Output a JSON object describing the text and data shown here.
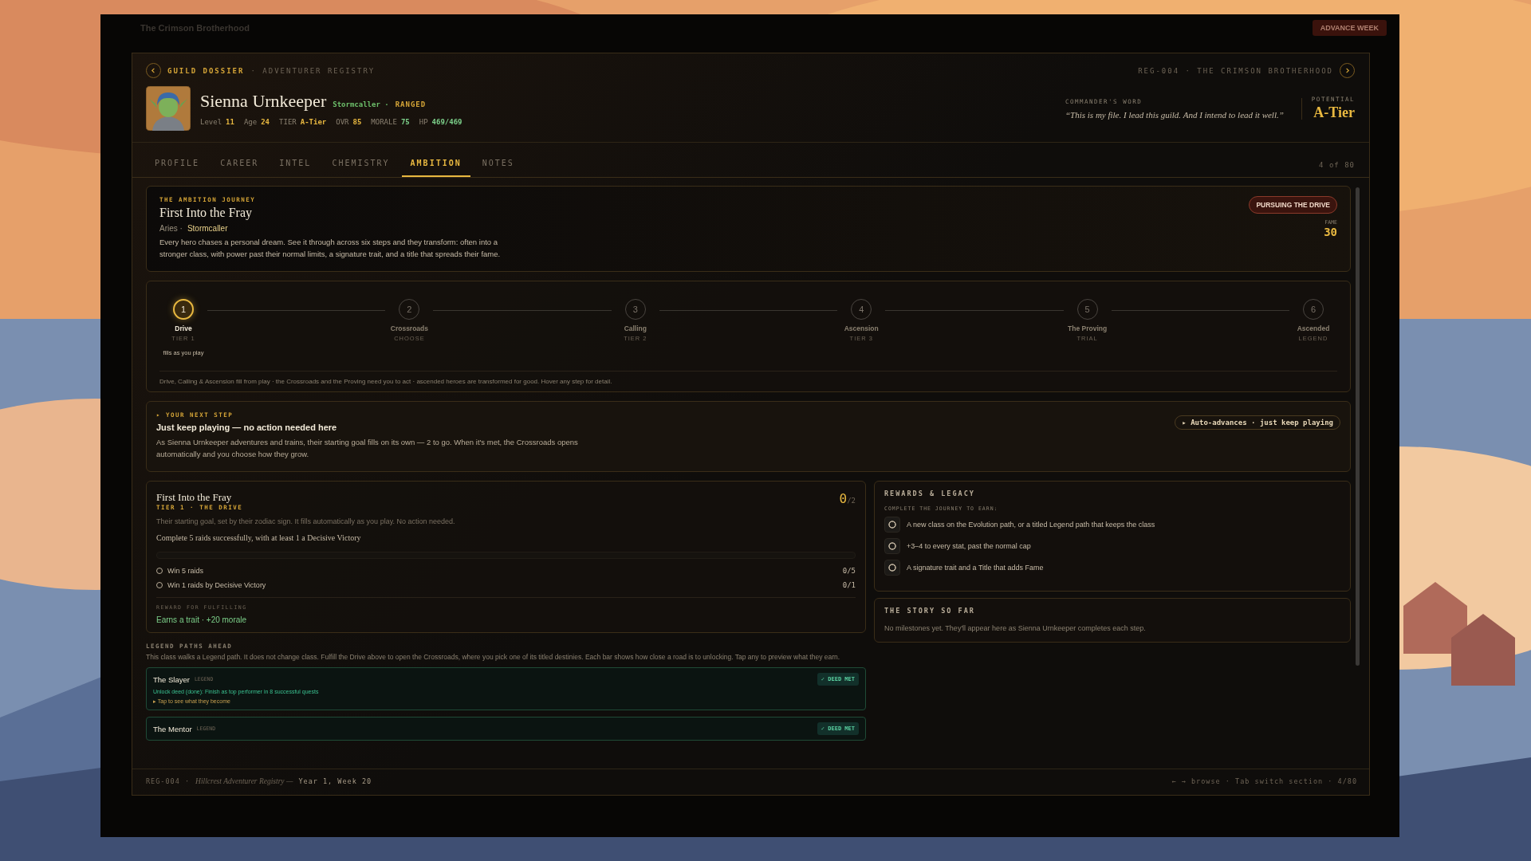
{
  "app": {
    "title": "The Crimson Brotherhood",
    "action": "ADVANCE WEEK"
  },
  "dossier": {
    "crumb": "GUILD DOSSIER",
    "crumb_sub": "· ADVENTURER REGISTRY",
    "registry": "REG-004 · THE CRIMSON BROTHERHOOD"
  },
  "hero": {
    "name": "Sienna Urnkeeper",
    "class": "Stormcaller ·",
    "role": "RANGED",
    "stats": [
      {
        "label": "Level",
        "value": "11",
        "color": "#e8b840"
      },
      {
        "label": "Age",
        "value": "24",
        "color": "#e8b840"
      },
      {
        "label": "TIER",
        "value": "A-Tier",
        "color": "#e8b840"
      },
      {
        "label": "OVR",
        "value": "85",
        "color": "#e8b840"
      },
      {
        "label": "MORALE",
        "value": "75",
        "color": "#7cd08a"
      },
      {
        "label": "HP",
        "value": "469/469",
        "color": "#7cd08a"
      }
    ],
    "quote_label": "COMMANDER'S WORD",
    "quote": "“This is my file. I lead this guild. And I intend to lead it well.”",
    "potential_label": "POTENTIAL",
    "potential": "A-Tier"
  },
  "tabs": [
    {
      "label": "PROFILE",
      "selected": false
    },
    {
      "label": "CAREER",
      "selected": false
    },
    {
      "label": "INTEL",
      "selected": false
    },
    {
      "label": "CHEMISTRY",
      "selected": false
    },
    {
      "label": "AMBITION",
      "selected": true
    },
    {
      "label": "NOTES",
      "selected": false
    }
  ],
  "position": "4 of 80",
  "journey": {
    "eyebrow": "THE AMBITION JOURNEY",
    "title": "First Into the Fray",
    "sign": "Aries ·",
    "class": "Stormcaller",
    "text": "Every hero chases a personal dream. See it through across six steps and they transform: often into a stronger class, with power past their normal limits, a signature trait, and a title that spreads their fame.",
    "status": "PURSUING THE DRIVE",
    "fame_label": "FAME",
    "fame": "30"
  },
  "steps": [
    {
      "number": "1",
      "name": "Drive",
      "sub": "TIER 1",
      "note": "fills as you play",
      "selected": true
    },
    {
      "number": "2",
      "name": "Crossroads",
      "sub": "CHOOSE",
      "selected": false
    },
    {
      "number": "3",
      "name": "Calling",
      "sub": "TIER 2",
      "selected": false
    },
    {
      "number": "4",
      "name": "Ascension",
      "sub": "TIER 3",
      "selected": false
    },
    {
      "number": "5",
      "name": "The Proving",
      "sub": "TRIAL",
      "selected": false
    },
    {
      "number": "6",
      "name": "Ascended",
      "sub": "LEGEND",
      "selected": false
    }
  ],
  "steps_note": "Drive, Calling & Ascension fill from play · the Crossroads and the Proving need you to act · ascended heroes are transformed for good. Hover any step for detail.",
  "next_step": {
    "eyebrow": "▸ YOUR NEXT STEP",
    "title": "Just keep playing — no action needed here",
    "text": "As Sienna Urnkeeper adventures and trains, their starting goal fills on its own — 2 to go. When it's met, the Crossroads opens automatically and you choose how they grow.",
    "chip": "▸ Auto-advances · just keep playing"
  },
  "drive": {
    "title": "First Into the Fray",
    "tier": "TIER 1 · THE DRIVE",
    "count": "0",
    "total": "/2",
    "text": "Their starting goal, set by their zodiac sign. It fills automatically as you play. No action needed.",
    "goal": "Complete 5 raids successfully, with at least 1 a Decisive Victory",
    "level": 0,
    "tasks": [
      {
        "label": "Win 5 raids",
        "progress": "0/5",
        "checked": false
      },
      {
        "label": "Win 1 raids by Decisive Victory",
        "progress": "0/1",
        "checked": false
      }
    ],
    "reward_label": "REWARD FOR FULFILLING",
    "reward": "Earns a trait · +20 morale"
  },
  "legend": {
    "title": "LEGEND PATHS AHEAD",
    "text": "This class walks a Legend path. It does not change class. Fulfill the Drive above to open the Crossroads, where you pick one of its titled destinies. Each bar shows how close a road is to unlocking. Tap any to preview what they earn.",
    "paths": [
      {
        "name": "The Slayer",
        "tag": "LEGEND",
        "badge": "✓ DEED MET",
        "deed": "Unlock deed (done): Finish as top performer in 8 successful quests",
        "hint": "▸ Tap to see what they become",
        "met": true
      },
      {
        "name": "The Mentor",
        "tag": "LEGEND",
        "badge": "✓ DEED MET",
        "met": true
      }
    ]
  },
  "rewards": {
    "title": "REWARDS & LEGACY",
    "subtitle": "COMPLETE THE JOURNEY TO EARN:",
    "items": [
      {
        "label": "A new class on the Evolution path, or a titled Legend path that keeps the class"
      },
      {
        "label": "+3–4 to every stat, past the normal cap"
      },
      {
        "label": "A signature trait and a Title that adds Fame"
      }
    ]
  },
  "story": {
    "title": "THE STORY SO FAR",
    "text": "No milestones yet. They'll appear here as Sienna Urnkeeper completes each step."
  },
  "footer": {
    "code": "REG-004 ·",
    "registry": "Hillcrest Adventurer Registry —",
    "date": "Year 1, Week 20",
    "hint": "← → browse · Tab switch section · 4/80"
  }
}
